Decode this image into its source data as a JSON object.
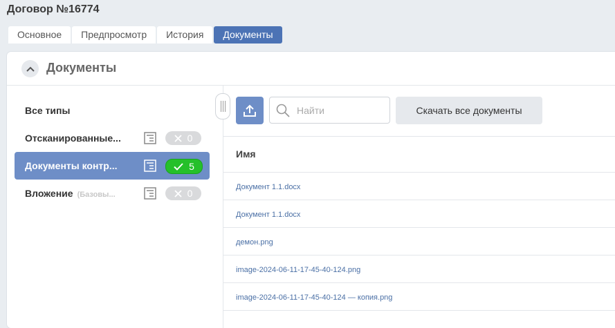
{
  "page": {
    "title": "Договор №16774"
  },
  "tabs": [
    {
      "label": "Основное",
      "active": false
    },
    {
      "label": "Предпросмотр",
      "active": false
    },
    {
      "label": "История",
      "active": false
    },
    {
      "label": "Документы",
      "active": true
    }
  ],
  "panel": {
    "title": "Документы",
    "collapse_icon": "chevron-up-icon"
  },
  "types": {
    "all": {
      "label": "Все типы"
    },
    "items": [
      {
        "label": "Отсканированные...",
        "sub": "",
        "count": "0",
        "status": "x-icon",
        "selected": false
      },
      {
        "label": "Документы контр...",
        "sub": "",
        "count": "5",
        "status": "check-icon",
        "selected": true
      },
      {
        "label": "Вложение",
        "sub": "(Базовы...",
        "count": "0",
        "status": "x-icon",
        "selected": false
      }
    ]
  },
  "toolbar": {
    "upload_icon": "upload-icon",
    "search_placeholder": "Найти",
    "search_value": "",
    "download_all_label": "Скачать все документы"
  },
  "table": {
    "header": "Имя",
    "rows": [
      "Документ 1.1.docx",
      "Документ 1.1.docx",
      "демон.png",
      "image-2024-06-11-17-45-40-124.png",
      "image-2024-06-11-17-45-40-124 — копия.png"
    ]
  },
  "colors": {
    "accent": "#4c73b5",
    "selected": "#6e8ec7",
    "ok": "#25c02a",
    "neutral_pill": "#d9dadc",
    "link": "#4a6fa5"
  }
}
